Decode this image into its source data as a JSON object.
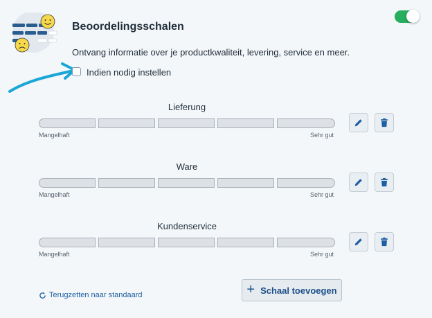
{
  "header": {
    "title": "Beoordelingsschalen",
    "description": "Ontvang informatie over je productkwaliteit, levering, service en meer.",
    "toggle_on": true,
    "checkbox_label": "Indien nodig instellen",
    "checkbox_checked": false
  },
  "scales": [
    {
      "title": "Lieferung",
      "min_label": "Mangelhaft",
      "max_label": "Sehr gut"
    },
    {
      "title": "Ware",
      "min_label": "Mangelhaft",
      "max_label": "Sehr gut"
    },
    {
      "title": "Kundenservice",
      "min_label": "Mangelhaft",
      "max_label": "Sehr gut"
    }
  ],
  "footer": {
    "reset_label": "Terugzetten naar standaard",
    "add_label": "Schaal toevoegen"
  },
  "icons": {
    "edit": "pencil-icon",
    "delete": "trash-icon",
    "reset": "refresh-icon",
    "add": "plus-icon"
  },
  "colors": {
    "accent": "#1d5fa3",
    "toggle_on": "#27ae5f",
    "arrow": "#1aa6d6",
    "background": "#f4f7f9"
  }
}
